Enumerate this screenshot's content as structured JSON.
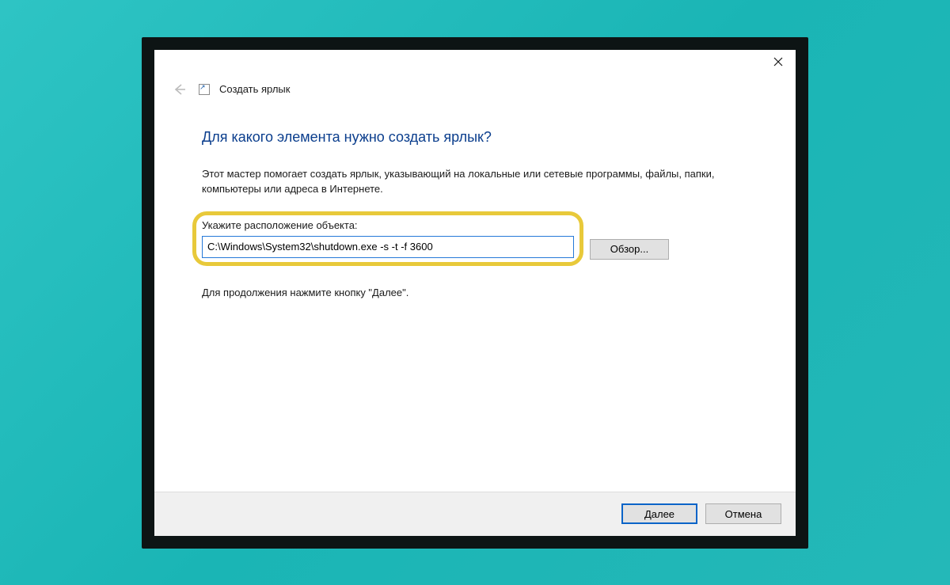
{
  "wizard": {
    "title": "Создать ярлык",
    "heading": "Для какого элемента нужно создать ярлык?",
    "description": "Этот мастер помогает создать ярлык, указывающий на локальные или сетевые программы, файлы, папки, компьютеры или адреса в Интернете.",
    "location_label": "Укажите расположение объекта:",
    "location_value": "C:\\Windows\\System32\\shutdown.exe -s -t -f 3600",
    "browse_label": "Обзор...",
    "continue_hint": "Для продолжения нажмите кнопку \"Далее\"."
  },
  "footer": {
    "next_label": "Далее",
    "cancel_label": "Отмена"
  }
}
